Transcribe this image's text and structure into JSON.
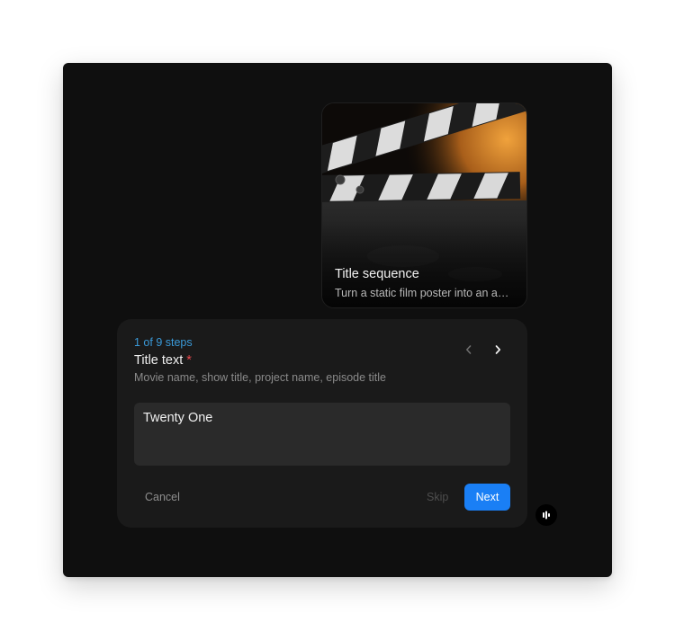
{
  "template_card": {
    "title": "Title sequence",
    "description": "Turn a static film poster into an animated title sequence"
  },
  "step_panel": {
    "counter": "1 of 9 steps",
    "field_label": "Title text",
    "required_marker": "*",
    "hint": "Movie name, show title, project name, episode title",
    "input_value": "Twenty One",
    "cancel_label": "Cancel",
    "skip_label": "Skip",
    "next_label": "Next"
  },
  "icons": {
    "prev": "chevron-left-icon",
    "next": "chevron-right-icon",
    "assistant": "audio-bars-icon"
  },
  "colors": {
    "accent": "#1a7ff5",
    "step_counter": "#3a9ad9",
    "required": "#e5484d",
    "background": "#0f0f0f",
    "panel": "#1a1a1a"
  }
}
